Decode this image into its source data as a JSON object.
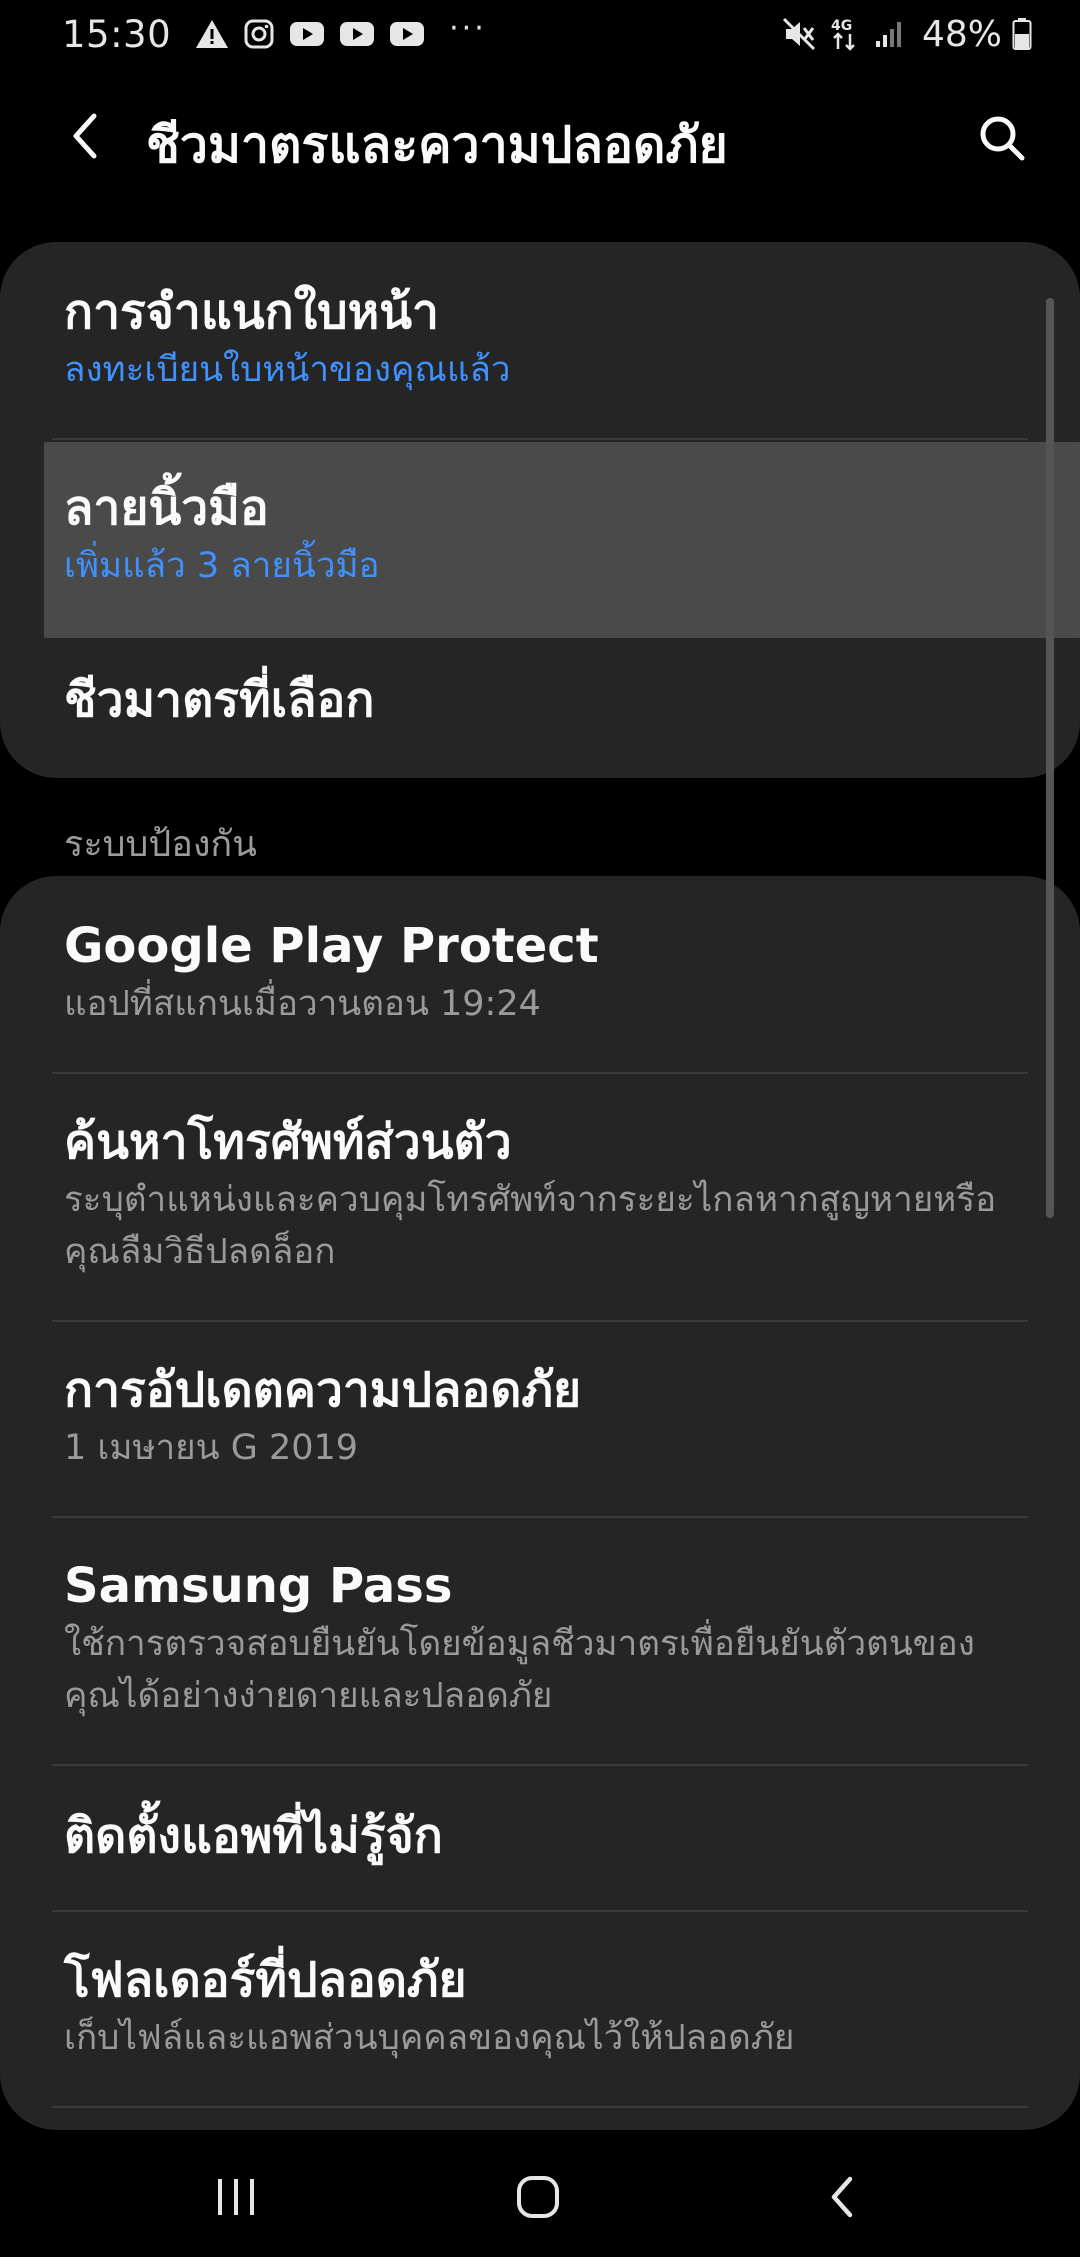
{
  "status_bar": {
    "time": "15:30",
    "battery_percent": "48%",
    "network_label": "4G",
    "overflow_dots": "···",
    "icons": [
      "alert-icon",
      "instagram-icon",
      "youtube-icon",
      "youtube-icon",
      "youtube-icon",
      "mute-icon",
      "network-4g-icon",
      "signal-icon",
      "battery-icon"
    ]
  },
  "header": {
    "title": "ชีวมาตรและความปลอดภัย",
    "back_icon": "back-icon",
    "search_icon": "search-icon"
  },
  "biometrics": {
    "items": [
      {
        "title": "การจำแนกใบหน้า",
        "subtitle": "ลงทะเบียนใบหน้าของคุณแล้ว"
      },
      {
        "title": "ลายนิ้วมือ",
        "subtitle": "เพิ่มแล้ว 3 ลายนิ้วมือ"
      },
      {
        "title": "ชีวมาตรที่เลือก"
      }
    ]
  },
  "protection": {
    "section_title": "ระบบป้องกัน",
    "items": [
      {
        "title": "Google Play Protect",
        "subtitle": "แอปที่สแกนเมื่อวานตอน 19:24"
      },
      {
        "title": "ค้นหาโทรศัพท์ส่วนตัว",
        "subtitle": "ระบุตำแหน่งและควบคุมโทรศัพท์จากระยะไกลหากสูญหายหรือคุณลืมวิธีปลดล็อก"
      },
      {
        "title": "การอัปเดตความปลอดภัย",
        "subtitle": "1 เมษายน G 2019"
      },
      {
        "title": "Samsung Pass",
        "subtitle": "ใช้การตรวจสอบยืนยันโดยข้อมูลชีวมาตรเพื่อยืนยันตัวตนของคุณได้อย่างง่ายดายและปลอดภัย"
      },
      {
        "title": "ติดตั้งแอพที่ไม่รู้จัก"
      },
      {
        "title": "โฟลเดอร์ที่ปลอดภัย",
        "subtitle": "เก็บไฟล์และแอพส่วนบุคคลของคุณไว้ให้ปลอดภัย"
      }
    ]
  },
  "nav_bar": {
    "icons": [
      "recent-apps-icon",
      "home-icon",
      "back-nav-icon"
    ]
  },
  "colors": {
    "background": "#000000",
    "card": "#252525",
    "accent": "#3e91ff",
    "subtitle": "#9a9a9a",
    "pressed": "#4a4a4a"
  }
}
